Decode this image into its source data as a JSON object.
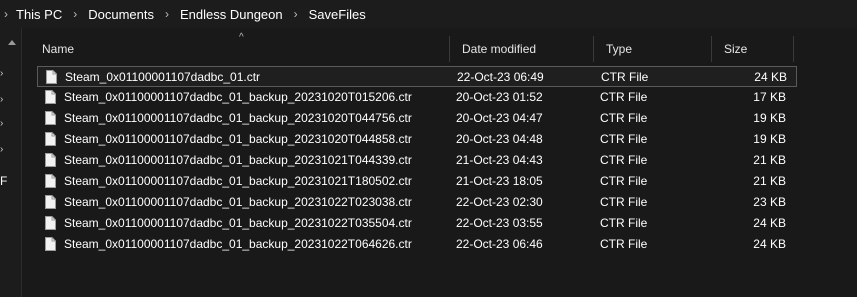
{
  "breadcrumb": {
    "items": [
      "This PC",
      "Documents",
      "Endless Dungeon",
      "SaveFiles"
    ],
    "separator": "›",
    "root_separator_icon": "chevron-right-icon"
  },
  "nav": {
    "cut_letter": "F"
  },
  "columns": {
    "name": "Name",
    "date": "Date modified",
    "type": "Type",
    "size": "Size",
    "sort_indicator": "^"
  },
  "files": [
    {
      "name": "Steam_0x01100001107dadbc_01.ctr",
      "date": "22-Oct-23 06:49",
      "type": "CTR File",
      "size": "24 KB",
      "selected": true
    },
    {
      "name": "Steam_0x01100001107dadbc_01_backup_20231020T015206.ctr",
      "date": "20-Oct-23 01:52",
      "type": "CTR File",
      "size": "17 KB"
    },
    {
      "name": "Steam_0x01100001107dadbc_01_backup_20231020T044756.ctr",
      "date": "20-Oct-23 04:47",
      "type": "CTR File",
      "size": "19 KB"
    },
    {
      "name": "Steam_0x01100001107dadbc_01_backup_20231020T044858.ctr",
      "date": "20-Oct-23 04:48",
      "type": "CTR File",
      "size": "19 KB"
    },
    {
      "name": "Steam_0x01100001107dadbc_01_backup_20231021T044339.ctr",
      "date": "21-Oct-23 04:43",
      "type": "CTR File",
      "size": "21 KB"
    },
    {
      "name": "Steam_0x01100001107dadbc_01_backup_20231021T180502.ctr",
      "date": "21-Oct-23 18:05",
      "type": "CTR File",
      "size": "21 KB"
    },
    {
      "name": "Steam_0x01100001107dadbc_01_backup_20231022T023038.ctr",
      "date": "22-Oct-23 02:30",
      "type": "CTR File",
      "size": "23 KB"
    },
    {
      "name": "Steam_0x01100001107dadbc_01_backup_20231022T035504.ctr",
      "date": "22-Oct-23 03:55",
      "type": "CTR File",
      "size": "24 KB"
    },
    {
      "name": "Steam_0x01100001107dadbc_01_backup_20231022T064626.ctr",
      "date": "22-Oct-23 06:46",
      "type": "CTR File",
      "size": "24 KB"
    }
  ],
  "colors": {
    "background": "#191919",
    "text": "#ffffff",
    "header_text": "#e6e6e6",
    "selection_border": "#5a5a5a"
  }
}
